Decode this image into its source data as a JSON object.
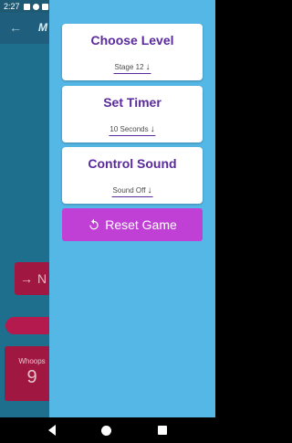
{
  "status": {
    "time": "2:27"
  },
  "background": {
    "title": "M",
    "next_label": "N",
    "score_label": "Whoops",
    "score_value": "9"
  },
  "drawer": {
    "cards": [
      {
        "title": "Choose Level",
        "selected": "Stage 12"
      },
      {
        "title": "Set Timer",
        "selected": "10 Seconds"
      },
      {
        "title": "Control Sound",
        "selected": "Sound Off"
      }
    ],
    "reset_label": "Reset Game"
  },
  "icons": {
    "dropdown": "arrow-down-icon",
    "reset": "restart-icon",
    "back": "arrow-left-icon"
  },
  "colors": {
    "drawer": "#54b7e6",
    "card_title": "#5a2a9c",
    "reset_button": "#c040d6"
  }
}
